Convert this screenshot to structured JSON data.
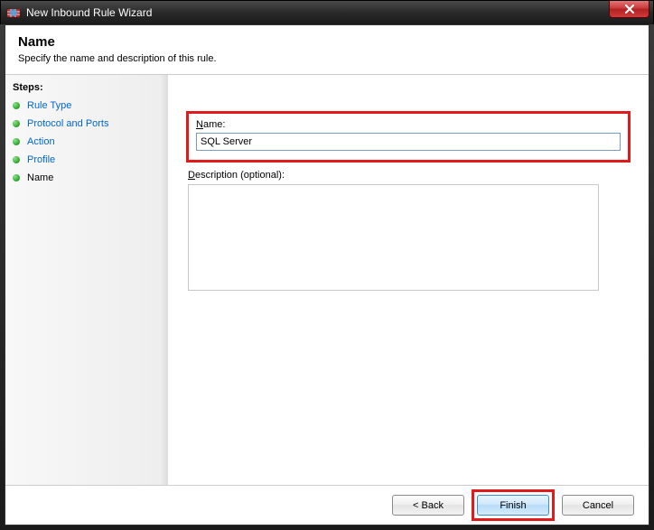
{
  "window": {
    "title": "New Inbound Rule Wizard"
  },
  "header": {
    "title": "Name",
    "subtitle": "Specify the name and description of this rule."
  },
  "steps": {
    "header": "Steps:",
    "items": [
      {
        "label": "Rule Type",
        "current": false
      },
      {
        "label": "Protocol and Ports",
        "current": false
      },
      {
        "label": "Action",
        "current": false
      },
      {
        "label": "Profile",
        "current": false
      },
      {
        "label": "Name",
        "current": true
      }
    ]
  },
  "form": {
    "name_label_pre": "N",
    "name_label_post": "ame:",
    "name_value": "SQL Server",
    "desc_label_pre": "D",
    "desc_label_post": "escription (optional):",
    "desc_value": ""
  },
  "buttons": {
    "back": "< Back",
    "finish": "Finish",
    "cancel": "Cancel"
  }
}
